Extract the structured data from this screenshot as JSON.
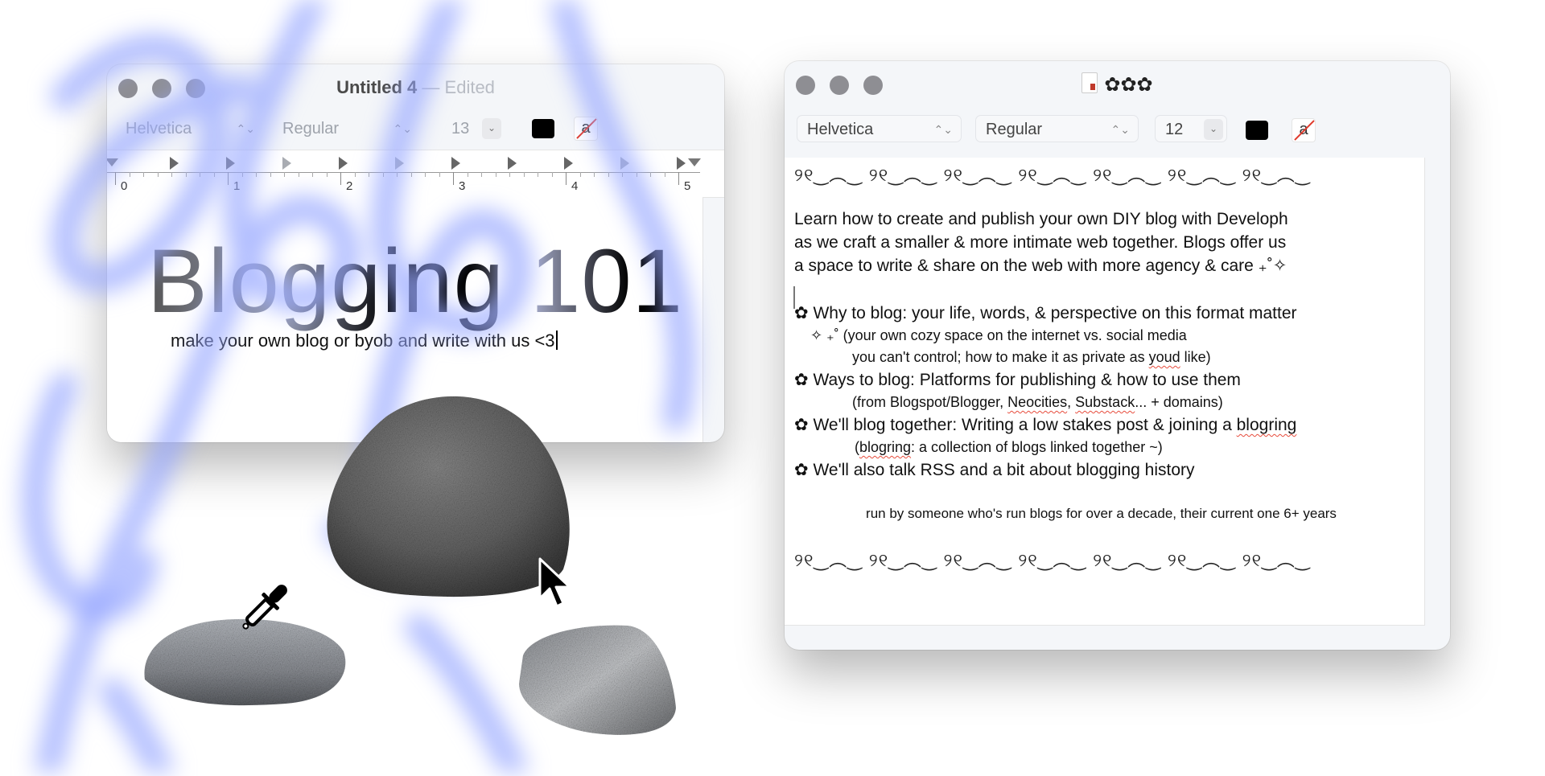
{
  "left_window": {
    "title": "Untitled 4",
    "title_separator": " — ",
    "title_status": "Edited",
    "toolbar": {
      "font_family": "Helvetica",
      "font_style": "Regular",
      "font_size": "13",
      "text_color": "#000000",
      "highlight_label": "a"
    },
    "ruler_numbers": [
      "0",
      "1",
      "2",
      "3",
      "4",
      "5"
    ],
    "document": {
      "heading": "Blogging 101",
      "subtitle": "make your own blog or byob and write with us <3"
    }
  },
  "right_window": {
    "title_icon": "document-icon",
    "title": "✿✿✿",
    "toolbar": {
      "font_family": "Helvetica",
      "font_style": "Regular",
      "font_size": "12",
      "text_color": "#000000",
      "highlight_label": "a"
    },
    "document": {
      "border_top": "୨୧‿︵‿ ୨୧‿︵‿ ୨୧‿︵‿ ୨୧‿︵‿ ୨୧‿︵‿ ୨୧‿︵‿ ୨୧‿︵‿",
      "intro_lines": [
        "Learn how to create and publish your own DIY blog with Developh",
        "as we craft a smaller & more intimate web together. Blogs offer us",
        "a space to write & share on the web with more agency & care ₊˚✧"
      ],
      "bullets": [
        {
          "marker": "✿",
          "text": "Why to blog: your life, words, & perspective on this format matter",
          "details": [
            {
              "prefix": "✧ ₊˚ ",
              "text": "(your own cozy space on the internet vs. social media"
            },
            {
              "prefix": "",
              "text_before": "you can't control; how to make it as private as ",
              "misspelled": "youd",
              "text_after": " like)"
            }
          ]
        },
        {
          "marker": "✿",
          "text": "Ways to blog: Platforms for publishing & how to use them",
          "details": [
            {
              "text_before": "(from Blogspot/Blogger, ",
              "misspelled": "Neocities",
              "middle": ", ",
              "misspelled2": "Substack",
              "text_after": "... + domains)"
            }
          ]
        },
        {
          "marker": "✿",
          "text_before": "We'll blog together: Writing a low stakes post & joining a ",
          "misspelled": "blogring",
          "details": [
            {
              "text_before": "(",
              "misspelled": "blogring",
              "text_after": ": a collection of blogs linked together ~)"
            }
          ]
        },
        {
          "marker": "✿",
          "text": "We'll also talk RSS and a bit about blogging history"
        }
      ],
      "credit": "run by someone who's run blogs for over a decade, their current one 6+ years",
      "border_bottom": "୨୧‿︵‿ ୨୧‿︵‿ ୨୧‿︵‿ ୨୧‿︵‿ ୨୧‿︵‿ ୨୧‿︵‿ ୨୧‿︵‿"
    }
  },
  "decor": {
    "streak_color": "#8fa2ff",
    "cursor": "arrow-pointer",
    "tool": "eyedropper"
  }
}
